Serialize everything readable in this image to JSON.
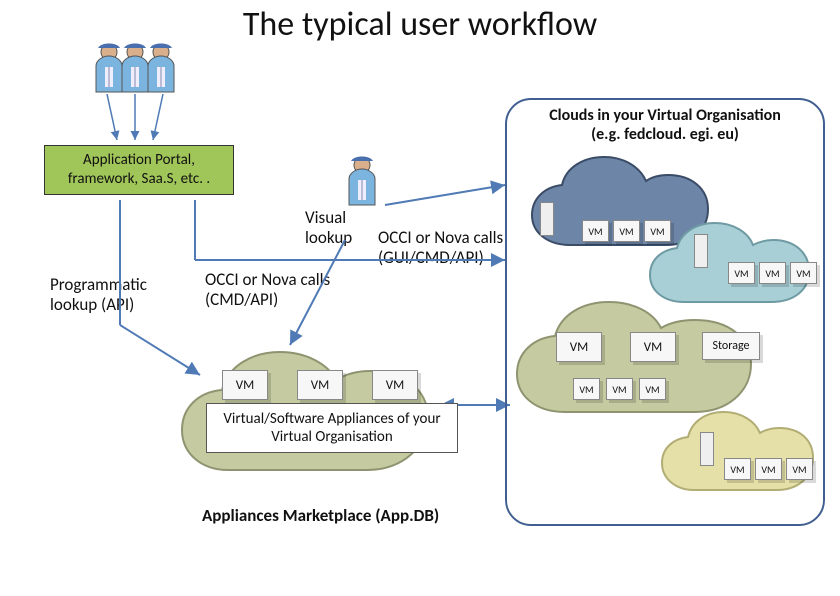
{
  "title": "The typical user workflow",
  "app_portal": "Application Portal, framework, Saa.S, etc. .",
  "labels": {
    "visual_lookup": "Visual lookup",
    "occi_gui": "OCCI or Nova calls (GUI/CMD/API)",
    "prog_lookup": "Programmatic lookup (API)",
    "occi_cmd": "OCCI or Nova calls (CMD/API)"
  },
  "clouds_box": {
    "line1": "Clouds in your Virtual Organisation",
    "line2": "(e.g. fedcloud. egi. eu)"
  },
  "vm": "VM",
  "storage": "Storage",
  "va_caption": "Virtual/Software Appliances of your Virtual Organisation",
  "marketplace": "Appliances Marketplace (App.DB)",
  "colors": {
    "cloud_dark": "#6d86a8",
    "cloud_teal": "#a9cfd6",
    "cloud_olive": "#c5caa1",
    "cloud_yellow": "#e4e0a7",
    "accent_blue": "#3f6aa5",
    "portal_green": "#a0c558"
  }
}
